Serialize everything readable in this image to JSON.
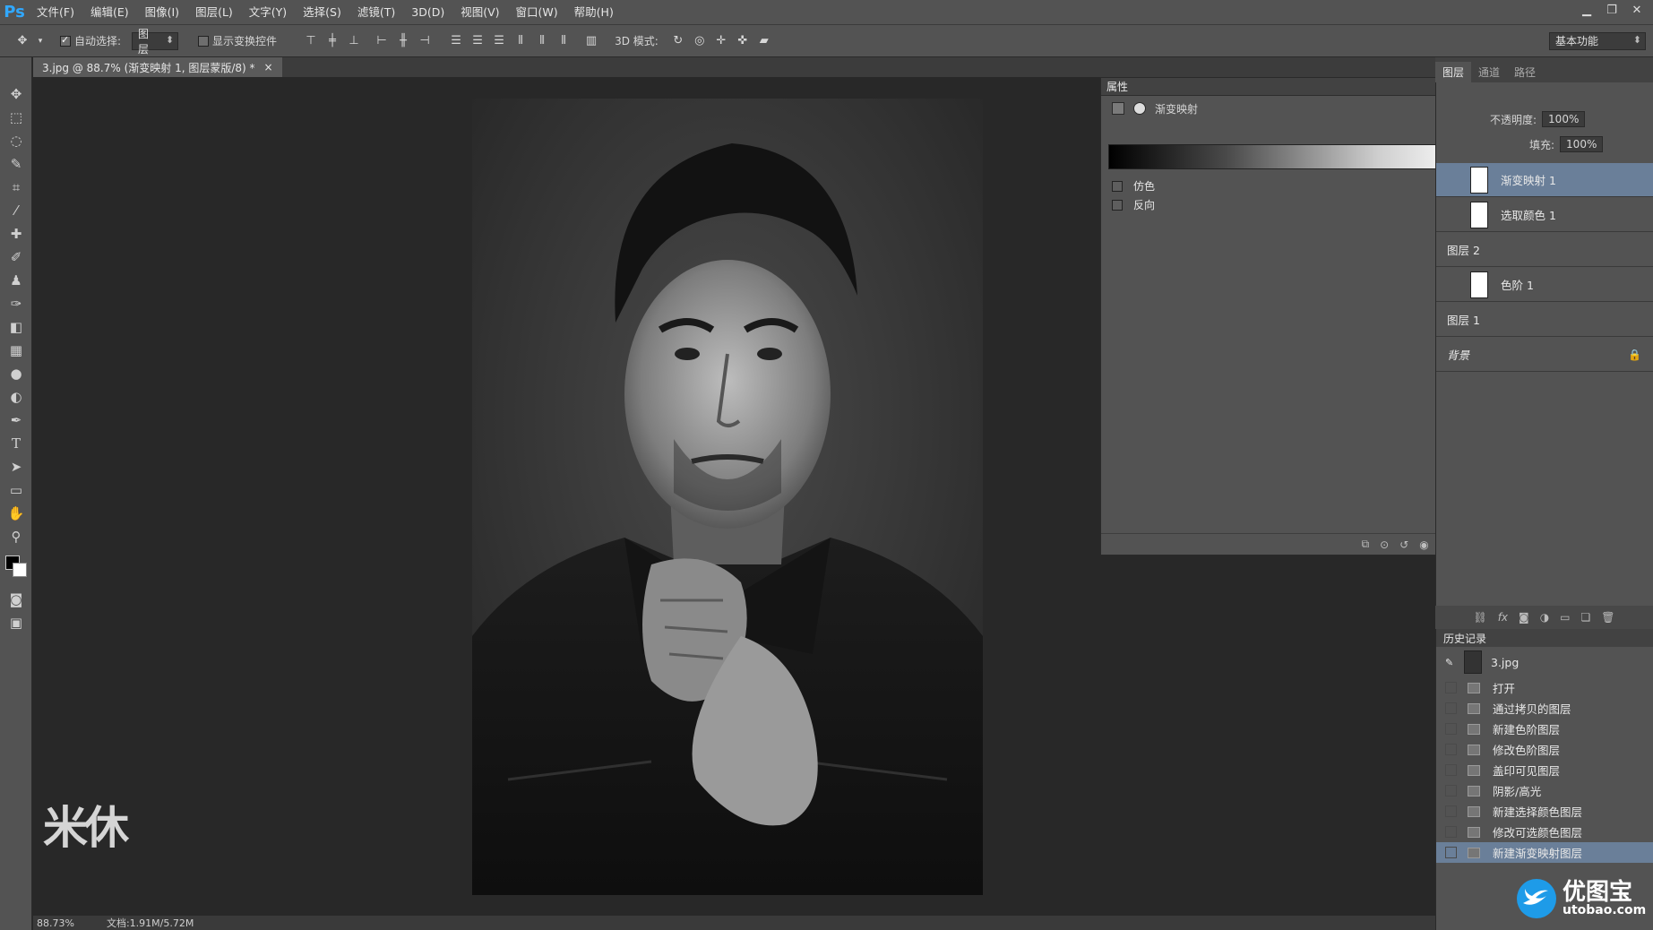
{
  "app": {
    "logo": "Ps"
  },
  "menu": [
    "文件(F)",
    "编辑(E)",
    "图像(I)",
    "图层(L)",
    "文字(Y)",
    "选择(S)",
    "滤镜(T)",
    "3D(D)",
    "视图(V)",
    "窗口(W)",
    "帮助(H)"
  ],
  "options": {
    "auto_select_label": "自动选择:",
    "auto_select_value": "图层",
    "show_transform_label": "显示变换控件",
    "mode_3d_label": "3D 模式:",
    "workspace": "基本功能"
  },
  "document": {
    "tab_title": "3.jpg @ 88.7% (渐变映射 1, 图层蒙版/8) *",
    "close": "×",
    "zoom": "88.73%",
    "doc_size": "文档:1.91M/5.72M"
  },
  "properties": {
    "title": "属性",
    "adjustment": "渐变映射",
    "dither": "仿色",
    "reverse": "反向"
  },
  "layers": {
    "tabs": [
      "图层",
      "通道",
      "路径"
    ],
    "opacity_label": "不透明度:",
    "opacity_value": "100%",
    "fill_label": "填充:",
    "fill_value": "100%",
    "items": [
      {
        "name": "渐变映射 1",
        "selected": true
      },
      {
        "name": "选取颜色 1",
        "selected": false
      },
      {
        "name": "图层 2",
        "selected": false
      },
      {
        "name": "色阶 1",
        "selected": false
      },
      {
        "name": "图层 1",
        "selected": false
      },
      {
        "name": "背景",
        "selected": false
      }
    ]
  },
  "history": {
    "title": "历史记录",
    "snapshot": "3.jpg",
    "items": [
      "打开",
      "通过拷贝的图层",
      "新建色阶图层",
      "修改色阶图层",
      "盖印可见图层",
      "阴影/高光",
      "新建选择颜色图层",
      "修改可选颜色图层",
      "新建渐变映射图层"
    ],
    "active_index": 8
  },
  "watermark": "米休",
  "brand": {
    "name": "优图宝",
    "url": "utobao.com",
    "accent": "#1e9be8"
  }
}
